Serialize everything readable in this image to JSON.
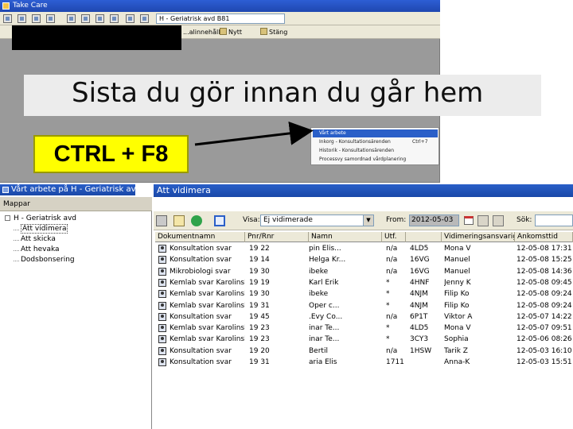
{
  "app": {
    "title": "Take Care",
    "unit_select": "H - Geriatrisk avd B81"
  },
  "toolbar2": {
    "item1": "...alinnehåll",
    "item2": "Nytt",
    "item3": "Stäng"
  },
  "heading": "Sista du gör innan du går hem",
  "shortcut": "CTRL + F8",
  "menu": {
    "items": [
      {
        "label": "Vårt arbete",
        "shortcut": ""
      },
      {
        "label": "Inkorg - Konsultationsärenden",
        "shortcut": "Ctrl+7"
      },
      {
        "label": "Historik - Konsultationsärenden",
        "shortcut": ""
      },
      {
        "label": "Processvy samordnad vårdplanering",
        "shortcut": ""
      }
    ]
  },
  "left_panel": {
    "title": "Vårt arbete på H - Geriatrisk avd",
    "folders_label": "Mappar",
    "root": "H - Geriatrisk avd",
    "children": [
      "Att vidimera",
      "Att skicka",
      "Att hevaka",
      "Dodsbonsering"
    ]
  },
  "right_panel": {
    "title": "Att vidimera",
    "view_label": "Visa:",
    "view_value": "Ej vidimerade",
    "from_label": "From:",
    "from_value": "2012-05-03",
    "search_label": "Sök:",
    "columns": [
      "Dokumentnamn",
      "Pnr/Rnr",
      "Namn",
      "Utf.",
      "",
      "Vidimeringsansvarig",
      "Ankomsttid"
    ],
    "rows": [
      [
        "Konsultation svar",
        "19 22",
        "pin Elis...",
        "n/a",
        "4LD5",
        "Mona V",
        "12-05-08 17:31"
      ],
      [
        "Konsultation svar",
        "19 14",
        "Helga Kr...",
        "n/a",
        "16VG",
        "Manuel",
        "12-05-08 15:25"
      ],
      [
        "Mikrobiologi svar",
        "19 30",
        "ibeke",
        "n/a",
        "16VG",
        "Manuel",
        "12-05-08 14:36"
      ],
      [
        "Kemlab svar Karolinska",
        "19 19",
        "Karl Erik",
        "*",
        "4HNF",
        "Jenny K",
        "12-05-08 09:45"
      ],
      [
        "Kemlab svar Karolinska",
        "19 30",
        "ibeke",
        "*",
        "4NJM",
        "Filip Ko",
        "12-05-08 09:24"
      ],
      [
        "Kemlab svar Karolinska",
        "19 31",
        "Oper c...",
        "*",
        "4NJM",
        "Filip Ko",
        "12-05-08 09:24"
      ],
      [
        "Konsultation svar",
        "19 45",
        ".Evy Co...",
        "n/a",
        "6P1T",
        "Viktor A",
        "12-05-07 14:22"
      ],
      [
        "Kemlab svar Karolinska",
        "19 23",
        "inar Te...",
        "*",
        "4LD5",
        "Mona V",
        "12-05-07 09:51"
      ],
      [
        "Kemlab svar Karolinska",
        "19 23",
        "inar Te...",
        "*",
        "3CY3",
        "Sophia",
        "12-05-06 08:26"
      ],
      [
        "Konsultation svar",
        "19 20",
        "Bertil",
        "n/a",
        "1HSW",
        "Tarik Z",
        "12-05-03 16:10"
      ],
      [
        "Konsultation svar",
        "19 31",
        "aria Elis",
        "1711",
        "",
        "Anna-K",
        "12-05-03 15:51"
      ]
    ]
  },
  "colors": {
    "title_blue": "#2a5fc8",
    "highlight": "#ffff00",
    "toolbar": "#ece9d8"
  }
}
